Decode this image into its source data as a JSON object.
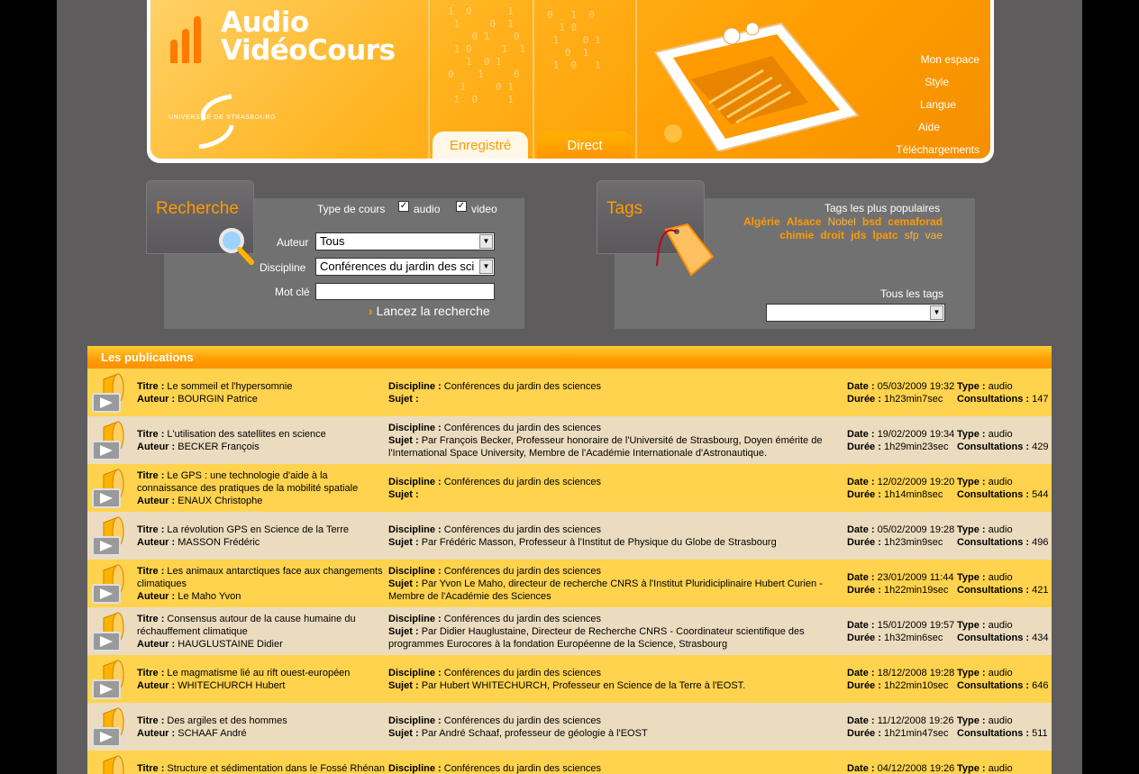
{
  "header": {
    "logo_line1": "Audio",
    "logo_line2": "VidéoCours",
    "university": "UNIVERSITÉ DE STRASBOURG",
    "tabs": [
      {
        "label": "Enregistré"
      },
      {
        "label": "Direct"
      }
    ],
    "nav": [
      {
        "label": "Mon espace"
      },
      {
        "label": "Style"
      },
      {
        "label": "Langue"
      },
      {
        "label": "Aide"
      },
      {
        "label": "Téléchargements"
      }
    ]
  },
  "search": {
    "title": "Recherche",
    "type_label": "Type de cours",
    "audio_label": "audio",
    "video_label": "video",
    "audio_checked": true,
    "video_checked": true,
    "author_label": "Auteur",
    "author_value": "Tous",
    "discipline_label": "Discipline",
    "discipline_value": "Conférences du jardin des sci",
    "keyword_label": "Mot clé",
    "keyword_value": "",
    "launch_label": "Lancez la recherche"
  },
  "tags": {
    "title": "Tags",
    "popular_label": "Tags les plus populaires",
    "line1": [
      {
        "label": "Algérie",
        "bold": true
      },
      {
        "label": "Alsace",
        "bold": true
      },
      {
        "label": "Nobel",
        "bold": false
      },
      {
        "label": "bsd",
        "bold": true
      },
      {
        "label": "cemaforad",
        "bold": true
      }
    ],
    "line2": [
      {
        "label": "chimie",
        "bold": true
      },
      {
        "label": "droit",
        "bold": true
      },
      {
        "label": "jds",
        "bold": true
      },
      {
        "label": "lpatc",
        "bold": true
      },
      {
        "label": "sfp",
        "bold": false
      },
      {
        "label": "vae",
        "bold": false
      }
    ],
    "all_label": "Tous les tags",
    "all_value": ""
  },
  "publications": {
    "title": "Les publications",
    "labels": {
      "titre": "Titre :",
      "auteur": "Auteur :",
      "discipline": "Discipline :",
      "sujet": "Sujet :",
      "date": "Date :",
      "duree": "Durée :",
      "type": "Type :",
      "consultations": "Consultations :"
    },
    "rows": [
      {
        "titre": "Le sommeil et l'hypersomnie",
        "auteur": "BOURGIN Patrice",
        "discipline": "Conférences du jardin des sciences",
        "sujet": "",
        "date": "05/03/2009 19:32",
        "duree": "1h23min7sec",
        "type": "audio",
        "consultations": "147"
      },
      {
        "titre": "L'utilisation des satellites en science",
        "auteur": "BECKER François",
        "discipline": "Conférences du jardin des sciences",
        "sujet": "Par François Becker, Professeur honoraire de l'Université de Strasbourg, Doyen émérite de l'International Space University, Membre de l'Académie Internationale d'Astronautique.",
        "date": "19/02/2009 19:34",
        "duree": "1h29min23sec",
        "type": "audio",
        "consultations": "429"
      },
      {
        "titre": "Le GPS : une technologie d'aide à la connaissance des pratiques de la mobilité spatiale",
        "auteur": "ENAUX Christophe",
        "discipline": "Conférences du jardin des sciences",
        "sujet": "",
        "date": "12/02/2009 19:20",
        "duree": "1h14min8sec",
        "type": "audio",
        "consultations": "544"
      },
      {
        "titre": "La révolution GPS en Science de la Terre",
        "auteur": "MASSON Frédéric",
        "discipline": "Conférences du jardin des sciences",
        "sujet": "Par Frédéric Masson, Professeur à l'Institut de Physique du Globe de Strasbourg",
        "date": "05/02/2009 19:28",
        "duree": "1h23min9sec",
        "type": "audio",
        "consultations": "496"
      },
      {
        "titre": "Les animaux antarctiques face aux changements climatiques",
        "auteur": "Le Maho Yvon",
        "discipline": "Conférences du jardin des sciences",
        "sujet": "Par Yvon Le Maho, directeur de recherche CNRS à l'Institut Pluridiciplinaire Hubert Curien - Membre de l'Académie des Sciences",
        "date": "23/01/2009 11:44",
        "duree": "1h22min19sec",
        "type": "audio",
        "consultations": "421"
      },
      {
        "titre": "Consensus autour de la cause humaine du réchauffement climatique",
        "auteur": "HAUGLUSTAINE Didier",
        "discipline": "Conférences du jardin des sciences",
        "sujet": "Par Didier Hauglustaine, Directeur de Recherche CNRS - Coordinateur scientifique des programmes Eurocores à la fondation Européenne de la Science, Strasbourg",
        "date": "15/01/2009 19:57",
        "duree": "1h32min6sec",
        "type": "audio",
        "consultations": "434"
      },
      {
        "titre": "Le magmatisme lié au rift ouest-européen",
        "auteur": "WHITECHURCH Hubert",
        "discipline": "Conférences du jardin des sciences",
        "sujet": "Par Hubert WHITECHURCH, Professeur en Science de la Terre à l'EOST.",
        "date": "18/12/2008 19:28",
        "duree": "1h22min10sec",
        "type": "audio",
        "consultations": "646"
      },
      {
        "titre": "Des argiles et des hommes",
        "auteur": "SCHAAF André",
        "discipline": "Conférences du jardin des sciences",
        "sujet": "Par André Schaaf, professeur de géologie à l'EOST",
        "date": "11/12/2008 19:26",
        "duree": "1h21min47sec",
        "type": "audio",
        "consultations": "511"
      },
      {
        "titre": "Structure et sédimentation dans le Fossé Rhénan",
        "auteur": "",
        "discipline": "Conférences du jardin des sciences",
        "sujet": "",
        "date": "04/12/2008 19:26",
        "duree": "",
        "type": "audio",
        "consultations": ""
      }
    ]
  },
  "colors": {
    "page_bg": "#5f5c5e",
    "accent": "#ff9a00",
    "row_odd": "#ffd34d",
    "row_even": "#ebdcbf"
  }
}
